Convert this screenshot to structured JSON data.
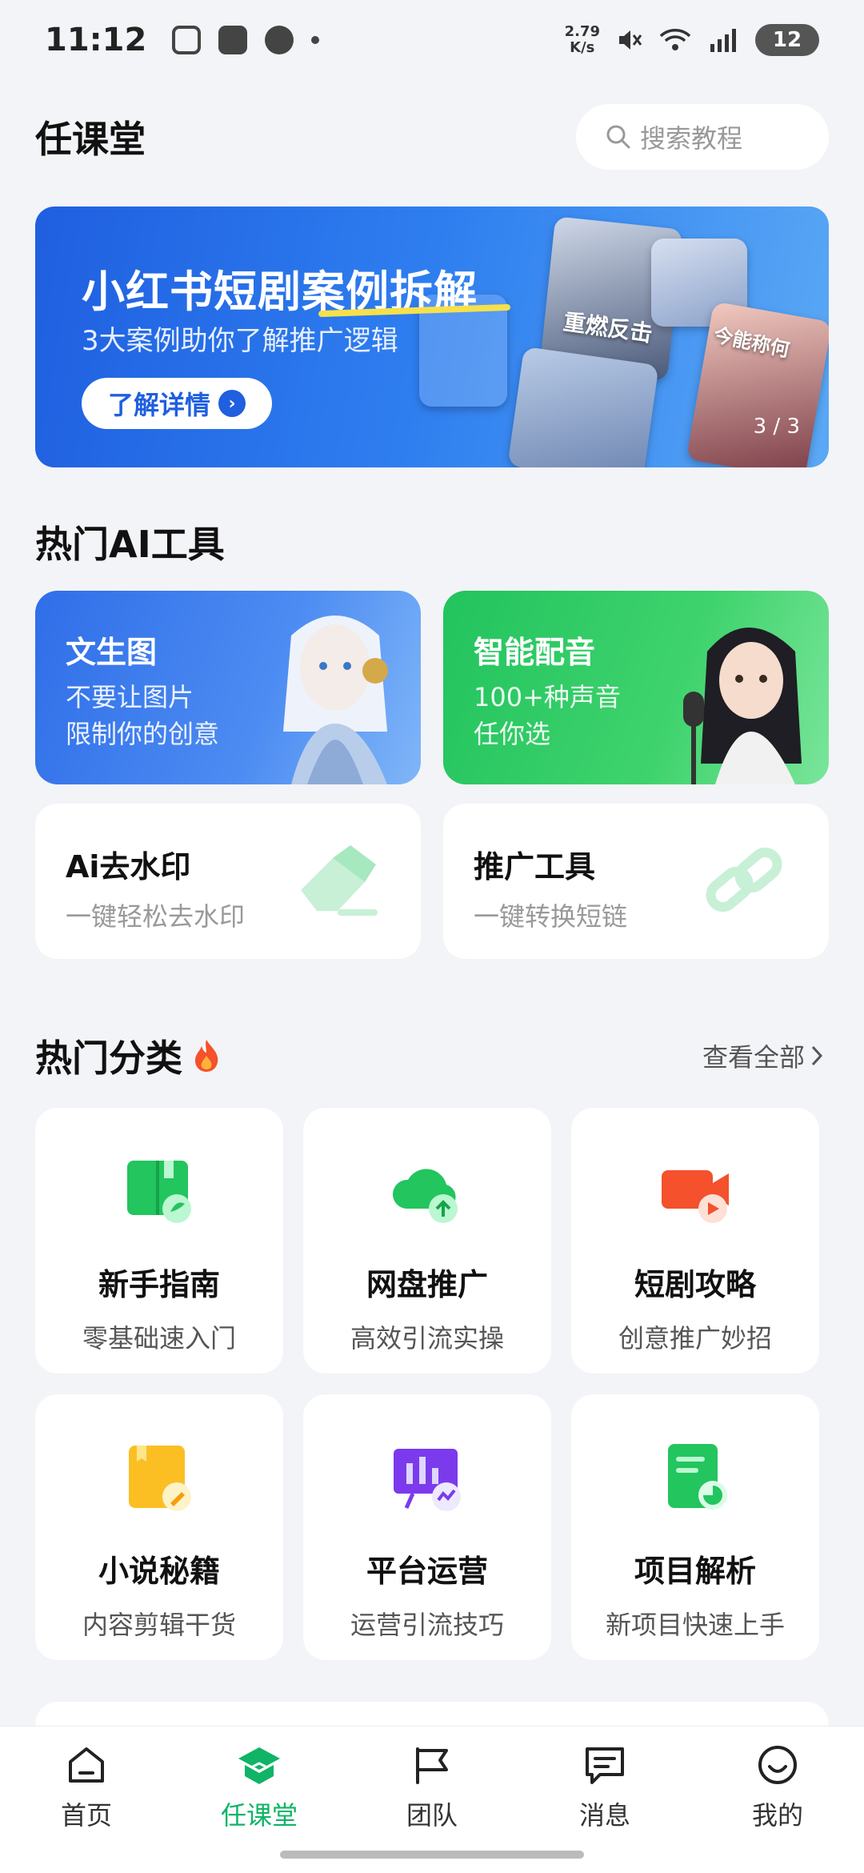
{
  "status_bar": {
    "time": "11:12",
    "net_speed_value": "2.79",
    "net_speed_unit": "K/s",
    "battery": "12"
  },
  "header": {
    "title": "任课堂",
    "search_placeholder": "搜索教程"
  },
  "banner": {
    "title": "小红书短剧案例拆解",
    "subtitle": "3大案例助你了解推广逻辑",
    "button_label": "了解详情",
    "poster_caption_1": "重燃反击",
    "poster_caption_2": "今能称何",
    "indicator": "3 / 3"
  },
  "hot_tools": {
    "title": "热门AI工具",
    "cards": [
      {
        "title": "文生图",
        "line1": "不要让图片",
        "line2": "限制你的创意"
      },
      {
        "title": "智能配音",
        "line1": "100+种声音",
        "line2": "任你选"
      }
    ],
    "small_cards": [
      {
        "title": "Ai去水印",
        "subtitle": "一键轻松去水印",
        "icon": "eraser-icon"
      },
      {
        "title": "推广工具",
        "subtitle": "一键转换短链",
        "icon": "link-icon"
      }
    ]
  },
  "categories": {
    "title": "热门分类",
    "view_all": "查看全部",
    "items": [
      {
        "title": "新手指南",
        "subtitle": "零基础速入门",
        "icon": "book-icon"
      },
      {
        "title": "网盘推广",
        "subtitle": "高效引流实操",
        "icon": "cloud-upload-icon"
      },
      {
        "title": "短剧攻略",
        "subtitle": "创意推广妙招",
        "icon": "video-camera-icon"
      },
      {
        "title": "小说秘籍",
        "subtitle": "内容剪辑干货",
        "icon": "notebook-icon"
      },
      {
        "title": "平台运营",
        "subtitle": "运营引流技巧",
        "icon": "presentation-icon"
      },
      {
        "title": "项目解析",
        "subtitle": "新项目快速上手",
        "icon": "document-chart-icon"
      }
    ]
  },
  "bottom_nav": {
    "items": [
      {
        "label": "首页",
        "icon": "home-icon"
      },
      {
        "label": "任课堂",
        "icon": "course-icon"
      },
      {
        "label": "团队",
        "icon": "flag-icon"
      },
      {
        "label": "消息",
        "icon": "message-icon"
      },
      {
        "label": "我的",
        "icon": "profile-icon"
      }
    ],
    "active_index": 1
  },
  "colors": {
    "accent_green": "#10b466",
    "banner_blue": "#1f5fe0",
    "background": "#f3f4f7"
  }
}
